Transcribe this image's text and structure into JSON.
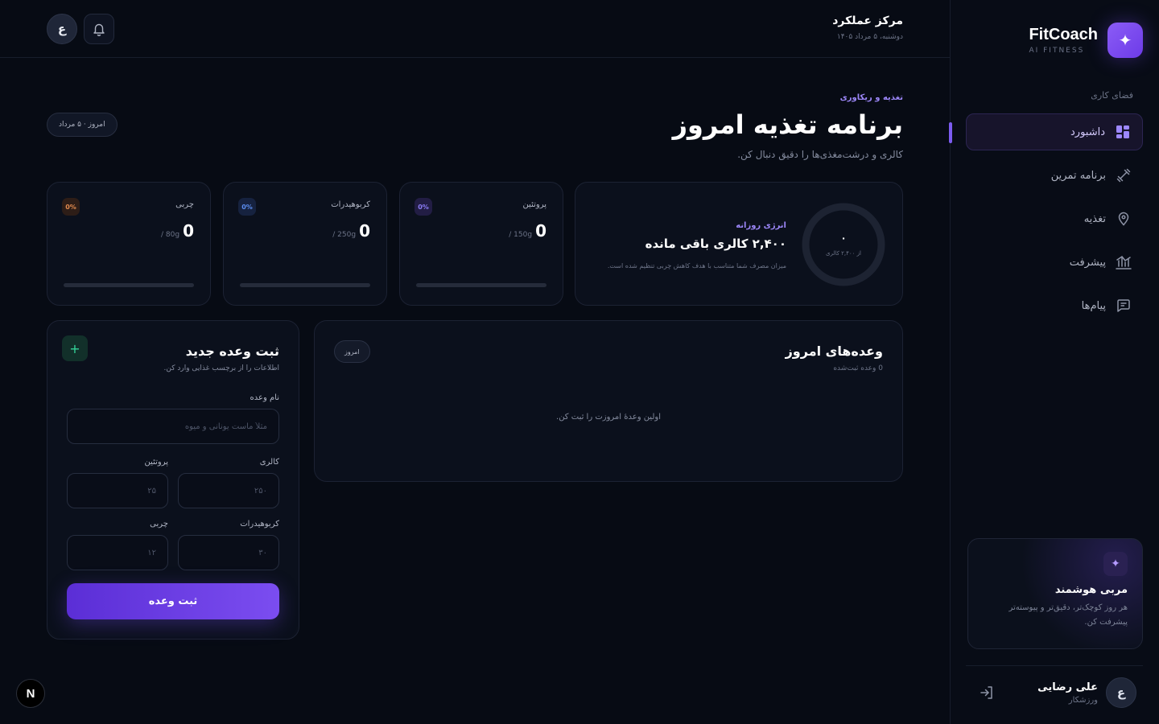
{
  "brand": {
    "name": "FitCoach",
    "sub": "AI FITNESS",
    "logo_icon": "sparkle-icon"
  },
  "sidebar": {
    "section_label": "فضای کاری",
    "items": [
      {
        "label": "داشبورد",
        "icon": "dashboard-icon",
        "active": true
      },
      {
        "label": "برنامه تمرین",
        "icon": "dumbbell-icon",
        "active": false
      },
      {
        "label": "تغذیه",
        "icon": "location-pin-icon",
        "active": false
      },
      {
        "label": "پیشرفت",
        "icon": "bar-chart-icon",
        "active": false
      },
      {
        "label": "پیام‌ها",
        "icon": "chat-icon",
        "active": false
      }
    ],
    "coach_card": {
      "title": "مربی هوشمند",
      "desc": "هر روز کوچک‌تر، دقیق‌تر و پیوسته‌تر پیشرفت کن."
    },
    "user": {
      "initial": "ع",
      "name": "علی رضایی",
      "role": "ورزشکار"
    }
  },
  "topbar": {
    "title": "مرکز عملکرد",
    "date": "دوشنبه، ۵ مرداد ۱۴۰۵",
    "avatar_initial": "ع"
  },
  "header": {
    "eyebrow": "تغذیه و ریکاوری",
    "title": "برنامه تغذیه امروز",
    "subtitle": "کالری و درشت‌مغذی‌ها را دقیق دنبال کن.",
    "date_pill": "امروز · ۵ مرداد"
  },
  "energy": {
    "ring_value": "۰",
    "ring_label": "از ۲,۴۰۰ کالری",
    "label": "انرژی روزانه",
    "remaining": "۲,۴۰۰ کالری باقی مانده",
    "desc": "میزان مصرف شما متناسب با هدف کاهش چربی تنظیم شده است.",
    "progress": 0
  },
  "macros": [
    {
      "name": "پروتئین",
      "value": "0",
      "target": "/ 150g",
      "badge": "0%",
      "color": "#8b7cf6",
      "badge_bg": "#221d44",
      "progress": 0
    },
    {
      "name": "کربوهیدرات",
      "value": "0",
      "target": "/ 250g",
      "badge": "0%",
      "color": "#5b8def",
      "badge_bg": "#16223f",
      "progress": 0
    },
    {
      "name": "چربی",
      "value": "0",
      "target": "/ 80g",
      "badge": "0%",
      "color": "#e08a4f",
      "badge_bg": "#2d1d17",
      "progress": 0
    }
  ],
  "meals": {
    "title": "وعده‌های امروز",
    "count": "0 وعده ثبت‌شده",
    "pill": "امروز",
    "empty": "اولین وعدهٔ امروزت را ثبت کن."
  },
  "new_meal": {
    "title": "ثبت وعده جدید",
    "subtitle": "اطلاعات را از برچسب غذایی وارد کن.",
    "fields": {
      "name": {
        "label": "نام وعده",
        "placeholder": "مثلاً ماست یونانی و میوه"
      },
      "calories": {
        "label": "کالری",
        "placeholder": "۲۵۰"
      },
      "protein": {
        "label": "پروتئین",
        "placeholder": "۲۵"
      },
      "carbs": {
        "label": "کربوهیدرات",
        "placeholder": "۳۰"
      },
      "fat": {
        "label": "چربی",
        "placeholder": "۱۲"
      }
    },
    "submit": "ثبت وعده"
  },
  "dev_badge": "N"
}
